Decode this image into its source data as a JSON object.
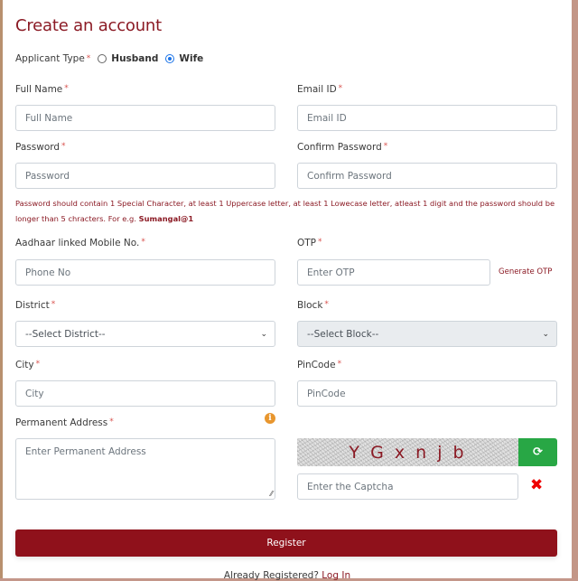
{
  "page": {
    "title": "Create an account"
  },
  "applicant_type": {
    "label": "Applicant Type",
    "required_mark": "*",
    "options": [
      {
        "label": "Husband",
        "selected": false
      },
      {
        "label": "Wife",
        "selected": true
      }
    ]
  },
  "fields": {
    "full_name": {
      "label": "Full Name",
      "placeholder": "Full Name"
    },
    "email": {
      "label": "Email ID",
      "placeholder": "Email ID"
    },
    "password": {
      "label": "Password",
      "placeholder": "Password"
    },
    "confirm_password": {
      "label": "Confirm Password",
      "placeholder": "Confirm Password"
    },
    "mobile": {
      "label": "Aadhaar linked Mobile No.",
      "placeholder": "Phone No"
    },
    "otp": {
      "label": "OTP",
      "placeholder": "Enter OTP",
      "action": "Generate OTP"
    },
    "district": {
      "label": "District",
      "selected": "--Select District--"
    },
    "block": {
      "label": "Block",
      "selected": "--Select Block--"
    },
    "city": {
      "label": "City",
      "placeholder": "City"
    },
    "pincode": {
      "label": "PinCode",
      "placeholder": "PinCode"
    },
    "address": {
      "label": "Permanent Address",
      "placeholder": "Enter Permanent Address"
    },
    "captcha": {
      "image_text": "Y G x n j b",
      "placeholder": "Enter the Captcha"
    }
  },
  "required_mark": "*",
  "password_hint": {
    "text": "Password should contain 1 Special Character, at least 1 Uppercase letter, at least 1 Lowecase letter, atleast 1 digit and the password should be longer than 5 chracters. For e.g. ",
    "example": "Sumangal@1"
  },
  "icons": {
    "info": "i",
    "refresh": "⟳",
    "clear": "✖",
    "chevron": "⌄",
    "resize": "⁄⁄"
  },
  "register_button": {
    "label": "Register"
  },
  "footer": {
    "text": "Already Registered? ",
    "link": "Log In"
  },
  "colors": {
    "brand": "#8f111b",
    "accent_text": "#8b1a24",
    "captcha_refresh": "#28a745",
    "clear_icon": "#ee0000",
    "info_icon": "#e8962e"
  }
}
